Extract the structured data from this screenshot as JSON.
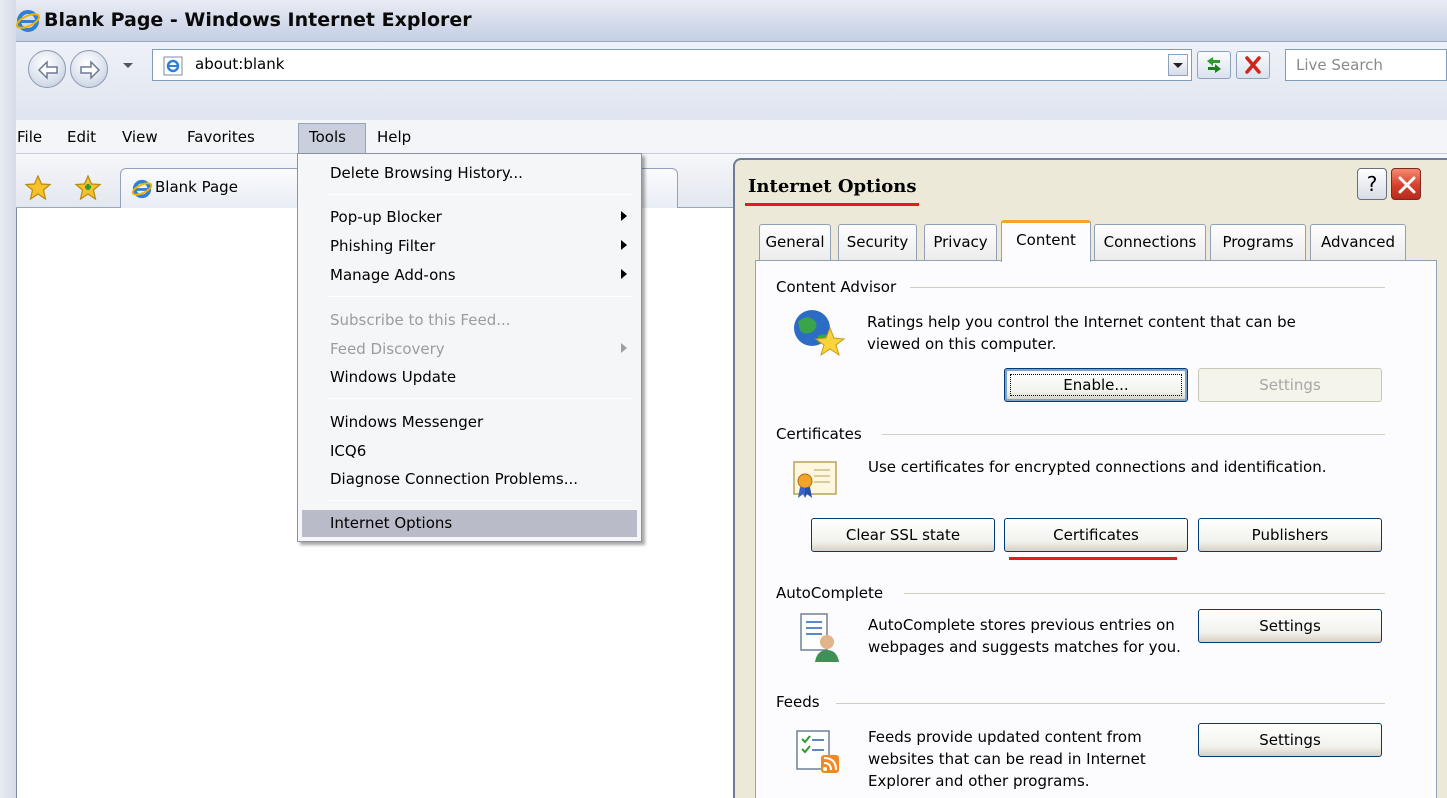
{
  "window": {
    "title": "Blank Page - Windows Internet Explorer"
  },
  "address_bar": {
    "url": "about:blank",
    "search_placeholder": "Live Search"
  },
  "menubar": {
    "items": [
      "File",
      "Edit",
      "View",
      "Favorites",
      "Tools",
      "Help"
    ]
  },
  "tab": {
    "label": "Blank Page"
  },
  "tools_menu": {
    "items": [
      {
        "label": "Delete Browsing History...",
        "disabled": false,
        "submenu": false
      },
      {
        "label": "Pop-up Blocker",
        "disabled": false,
        "submenu": true
      },
      {
        "label": "Phishing Filter",
        "disabled": false,
        "submenu": true
      },
      {
        "label": "Manage Add-ons",
        "disabled": false,
        "submenu": true
      },
      {
        "label": "Subscribe to this Feed...",
        "disabled": true,
        "submenu": false
      },
      {
        "label": "Feed Discovery",
        "disabled": true,
        "submenu": true
      },
      {
        "label": "Windows Update",
        "disabled": false,
        "submenu": false
      },
      {
        "label": "Windows Messenger",
        "disabled": false,
        "submenu": false
      },
      {
        "label": "ICQ6",
        "disabled": false,
        "submenu": false
      },
      {
        "label": "Diagnose Connection Problems...",
        "disabled": false,
        "submenu": false
      },
      {
        "label": "Internet Options",
        "disabled": false,
        "submenu": false,
        "highlighted": true
      }
    ]
  },
  "dialog": {
    "title": "Internet Options",
    "help_label": "?",
    "tabs": [
      "General",
      "Security",
      "Privacy",
      "Content",
      "Connections",
      "Programs",
      "Advanced"
    ],
    "active_tab": "Content",
    "content_advisor": {
      "label": "Content Advisor",
      "description": "Ratings help you control the Internet content that can be viewed on this computer.",
      "enable": "Enable...",
      "settings": "Settings"
    },
    "certificates": {
      "label": "Certificates",
      "description": "Use certificates for encrypted connections and identification.",
      "clear_ssl": "Clear SSL state",
      "certificates": "Certificates",
      "publishers": "Publishers"
    },
    "autocomplete": {
      "label": "AutoComplete",
      "description": "AutoComplete stores previous entries on webpages and suggests matches for you.",
      "settings": "Settings"
    },
    "feeds": {
      "label": "Feeds",
      "description": "Feeds provide updated content from websites that can be read in Internet Explorer and other programs.",
      "settings": "Settings"
    }
  },
  "colors": {
    "annotation_red": "#e21d1d",
    "active_tab_accent": "#f7a325",
    "dialog_bg": "#ece9d8"
  }
}
